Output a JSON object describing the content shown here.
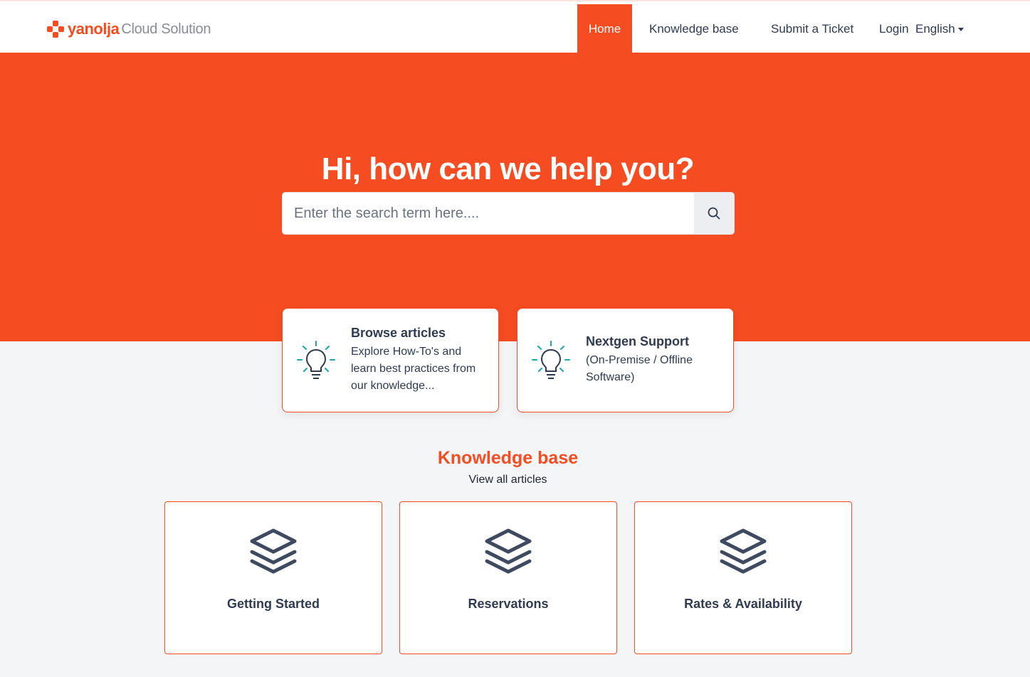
{
  "header": {
    "logo_brand": "yanolja",
    "logo_product": "Cloud Solution",
    "nav": {
      "home": "Home",
      "knowledge_base": "Knowledge base",
      "submit_ticket": "Submit a Ticket",
      "login": "Login",
      "language": "English"
    }
  },
  "hero": {
    "title": "Hi, how can we help you?",
    "search_placeholder": "Enter the search term here....",
    "search_icon": "search-icon"
  },
  "quick_links": [
    {
      "title": "Browse articles",
      "text": "Explore How-To's and learn best practices from our knowledge...",
      "icon": "lightbulb-icon"
    },
    {
      "title": "Nextgen Support",
      "text": "(On-Premise / Offline Software)",
      "icon": "lightbulb-icon"
    }
  ],
  "knowledge_base": {
    "title": "Knowledge base",
    "view_all": "View all articles",
    "categories": [
      {
        "label": "Getting Started",
        "icon": "layers-icon"
      },
      {
        "label": "Reservations",
        "icon": "layers-icon"
      },
      {
        "label": "Rates & Availability",
        "icon": "layers-icon"
      }
    ]
  },
  "colors": {
    "brand": "#f54c22",
    "text_dark": "#2f3b52",
    "icon_teal": "#1aa7a7",
    "page_bg": "#f4f5f7"
  }
}
